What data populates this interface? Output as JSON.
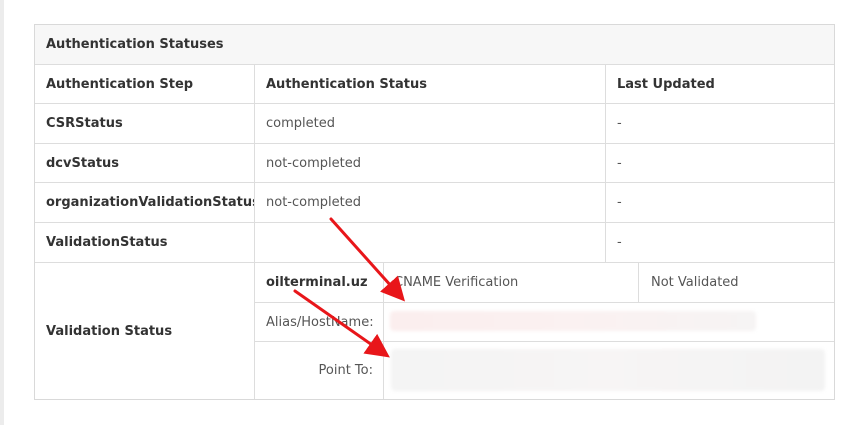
{
  "table": {
    "caption": "Authentication Statuses",
    "headers": [
      "Authentication Step",
      "Authentication Status",
      "Last Updated"
    ],
    "rows": [
      {
        "step": "CSRStatus",
        "status": "completed",
        "updated": "-"
      },
      {
        "step": "dcvStatus",
        "status": "not-completed",
        "updated": "-"
      },
      {
        "step": "organizationValidationStatus",
        "status": "not-completed",
        "updated": "-"
      },
      {
        "step": "ValidationStatus",
        "status": "",
        "updated": "-"
      }
    ],
    "validation": {
      "label": "Validation Status",
      "domain": "oilterminal.uz",
      "method": "CNAME Verification",
      "result": "Not Validated",
      "alias_label": "Alias/HostName:",
      "point_label": "Point To:"
    }
  },
  "colors": {
    "border": "#dddddd",
    "header_bg": "#f7f7f7",
    "arrow": "#e8161a"
  }
}
